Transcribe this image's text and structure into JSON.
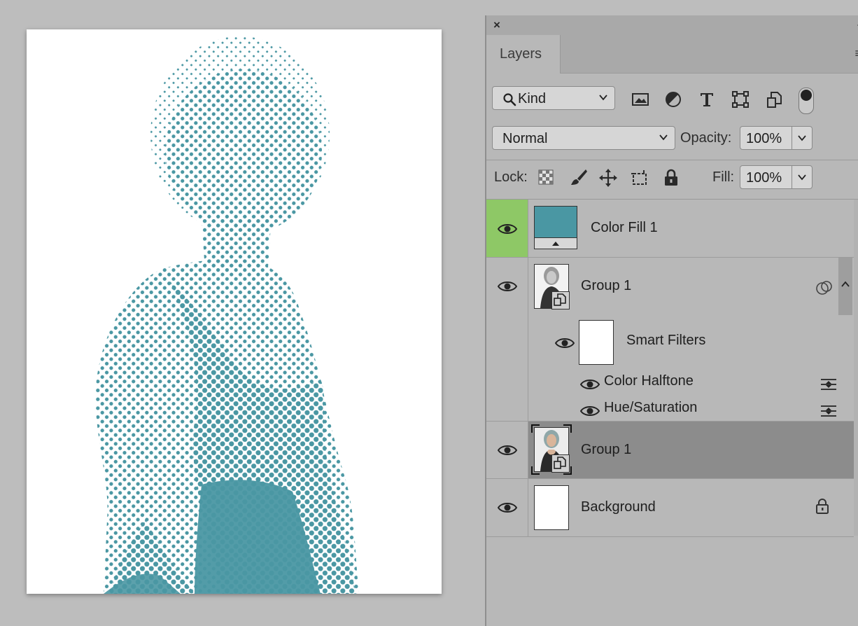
{
  "panel": {
    "tab_label": "Layers",
    "close_glyph": "×",
    "collapse_glyph": "‹",
    "menu_glyph": "≡",
    "filter": {
      "label": "Kind",
      "icon": "search-icon"
    },
    "filter_icons": [
      "image-filter-icon",
      "adjustment-filter-icon",
      "type-filter-icon",
      "shape-filter-icon",
      "smart-object-filter-icon",
      "filter-toggle-switch"
    ],
    "blend_mode": "Normal",
    "opacity_label": "Opacity:",
    "opacity_value": "100%",
    "lock_label": "Lock:",
    "lock_icons": [
      "lock-transparent-pixels-icon",
      "lock-image-pixels-icon",
      "lock-position-icon",
      "lock-artboard-icon",
      "lock-all-icon"
    ],
    "fill_label": "Fill:",
    "fill_value": "100%"
  },
  "layers": [
    {
      "name": "Color Fill 1",
      "type": "fill",
      "fill_color": "#4a97a3",
      "selected_eye_bg": "#8ec866"
    },
    {
      "name": "Group 1",
      "type": "smart-object",
      "badge": "linked-smart-object-icon"
    },
    {
      "name": "Smart Filters",
      "type": "smart-filters"
    },
    {
      "name": "Color Halftone",
      "type": "filter",
      "icon": "filter-options-icon"
    },
    {
      "name": "Hue/Saturation",
      "type": "filter",
      "icon": "filter-options-icon"
    },
    {
      "name": "Group 1",
      "type": "smart-object",
      "selected": true
    },
    {
      "name": "Background",
      "type": "background",
      "badge": "lock-icon"
    }
  ],
  "colors": {
    "halftone": "#4a97a3",
    "selected_row": "#8c8c8c",
    "panel_bg": "#b8b8b8"
  }
}
